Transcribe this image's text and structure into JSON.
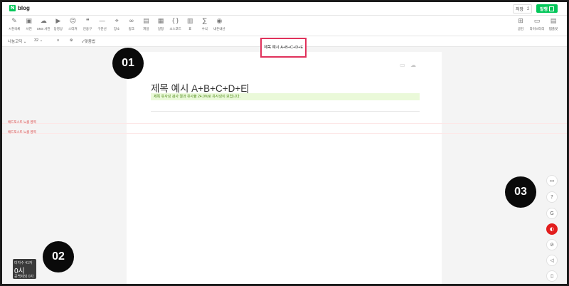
{
  "app": {
    "logo_badge": "N",
    "logo_text": "blog"
  },
  "topbar": {
    "save_label": "저장",
    "save_count": "2",
    "publish_label": "발행",
    "publish_icon": "page"
  },
  "toolbar": {
    "tools": [
      {
        "icon": "✎",
        "label": "ㅊ천국체"
      },
      {
        "icon": "▣",
        "label": "사진"
      },
      {
        "icon": "☁",
        "label": "SNS 사진"
      },
      {
        "icon": "▶",
        "label": "동영상"
      },
      {
        "icon": "☺",
        "label": "스티커"
      },
      {
        "icon": "❝",
        "label": "인용구"
      },
      {
        "icon": "—",
        "label": "구분선"
      },
      {
        "icon": "⌖",
        "label": "장소"
      },
      {
        "icon": "∞",
        "label": "링크"
      },
      {
        "icon": "▤",
        "label": "파일"
      },
      {
        "icon": "▦",
        "label": "일정"
      },
      {
        "icon": "{}",
        "label": "소스코드"
      },
      {
        "icon": "▥",
        "label": "표"
      },
      {
        "icon": "∑",
        "label": "수식"
      },
      {
        "icon": "◉",
        "label": "내돈내산"
      }
    ],
    "right_tools": [
      {
        "icon": "⊞",
        "label": "글감"
      },
      {
        "icon": "▭",
        "label": "라이브러리"
      },
      {
        "icon": "▤",
        "label": "템플릿"
      }
    ]
  },
  "formatbar": {
    "font": "나눔고딕",
    "size": "32",
    "align_icon": "≡",
    "extra_icon": "⊗",
    "spell_label": "맞춤법"
  },
  "callout": {
    "text": "제목 예시 A+B+C+D+E"
  },
  "editor": {
    "title": "제목 예시 A+B+C+D+E",
    "similarity_text": "제목 유사성 검사 결과 유사율 24.0%로 유사성이 보입니다."
  },
  "ads": {
    "label_1": "애드포스트 노출 영역",
    "label_2": "애드포스트 노출 영역"
  },
  "markers": [
    "01",
    "02",
    "03"
  ],
  "side_tools": [
    {
      "icon": "▭",
      "name": "monitor"
    },
    {
      "icon": "?",
      "name": "help"
    },
    {
      "icon": "G",
      "name": "grammar"
    },
    {
      "icon": "◐",
      "name": "record"
    },
    {
      "icon": "⊘",
      "name": "mute-mic"
    },
    {
      "icon": "◁",
      "name": "sound"
    },
    {
      "icon": "▯",
      "name": "document"
    }
  ],
  "counter": {
    "line1": "미자수 41자",
    "line2": "0시",
    "line3": "공백제외 0자"
  },
  "colors": {
    "brand": "#03c75a",
    "callout_border": "#e0315b",
    "similarity_bg": "#eaf9d9",
    "marker": "#0a0a0a"
  }
}
